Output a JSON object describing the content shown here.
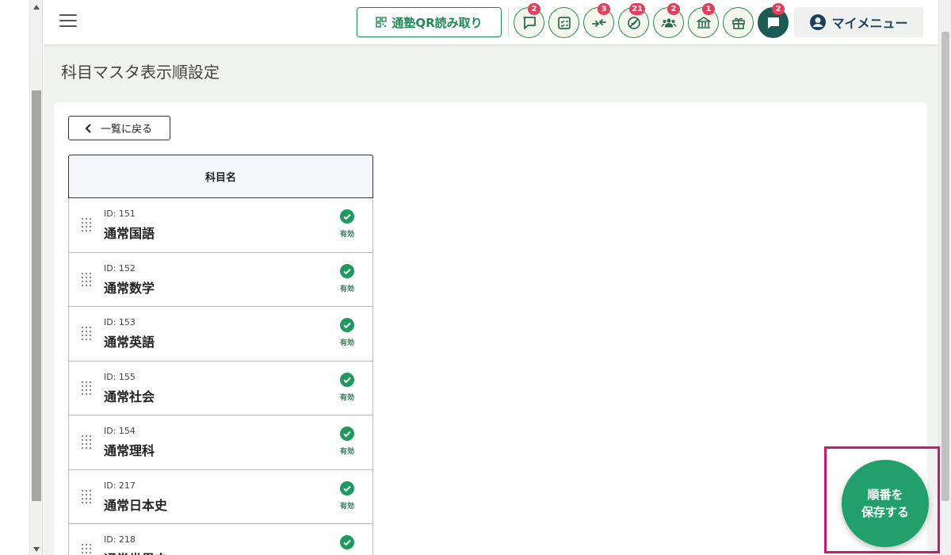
{
  "header": {
    "qr_button_label": "通塾QR読み取り",
    "icon_buttons": [
      {
        "icon": "chat-bubble-icon",
        "badge": "2"
      },
      {
        "icon": "checklist-icon",
        "badge": ""
      },
      {
        "icon": "arrows-in-icon",
        "badge": "3"
      },
      {
        "icon": "no-entry-icon",
        "badge": "21"
      },
      {
        "icon": "group-icon",
        "badge": "2"
      },
      {
        "icon": "school-building-icon",
        "badge": "1"
      },
      {
        "icon": "gift-icon",
        "badge": ""
      },
      {
        "icon": "message-icon",
        "badge": "2"
      }
    ],
    "my_menu_label": "マイメニュー"
  },
  "page": {
    "title": "科目マスタ表示順設定",
    "back_label": "一覧に戻る"
  },
  "table": {
    "column_header": "科目名",
    "rows": [
      {
        "id": "ID: 151",
        "name": "通常国語",
        "status": "有効"
      },
      {
        "id": "ID: 152",
        "name": "通常数学",
        "status": "有効"
      },
      {
        "id": "ID: 153",
        "name": "通常英語",
        "status": "有効"
      },
      {
        "id": "ID: 155",
        "name": "通常社会",
        "status": "有効"
      },
      {
        "id": "ID: 154",
        "name": "通常理科",
        "status": "有効"
      },
      {
        "id": "ID: 217",
        "name": "通常日本史",
        "status": "有効"
      },
      {
        "id": "ID: 218",
        "name": "通常世界史",
        "status": "有効"
      }
    ]
  },
  "save_button": {
    "line1": "順番を",
    "line2": "保存する"
  },
  "colors": {
    "accent": "#22a06b",
    "brand_dark": "#1a5c55",
    "badge": "#e0405e",
    "highlight": "#cc1a6e"
  }
}
